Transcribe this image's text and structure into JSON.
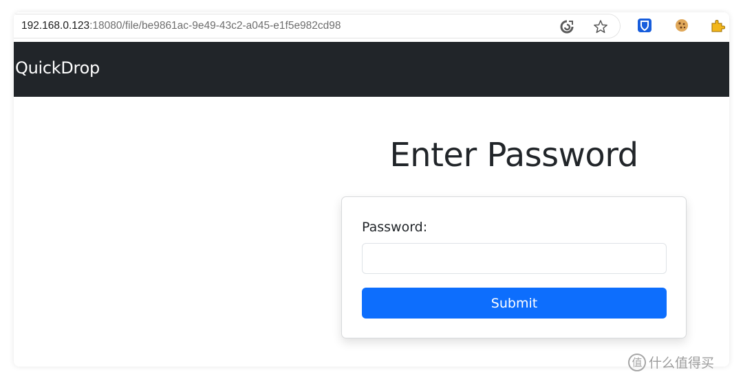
{
  "browser": {
    "url_host": "192.168.0.123",
    "url_path": ":18080/file/be9861ac-9e49-43c2-a045-e1f5e982cd98",
    "icons": [
      "refresh-icon",
      "favorite-star-icon",
      "bitwarden-icon",
      "cookie-icon",
      "puzzle-extension-icon"
    ]
  },
  "navbar": {
    "brand": "QuickDrop",
    "background": "#212529"
  },
  "main": {
    "title": "Enter Password",
    "form": {
      "password_label": "Password:",
      "password_value": "",
      "submit_label": "Submit",
      "accent": "#0d6efd"
    }
  },
  "watermark": {
    "logo_char": "值",
    "text": "什么值得买"
  }
}
